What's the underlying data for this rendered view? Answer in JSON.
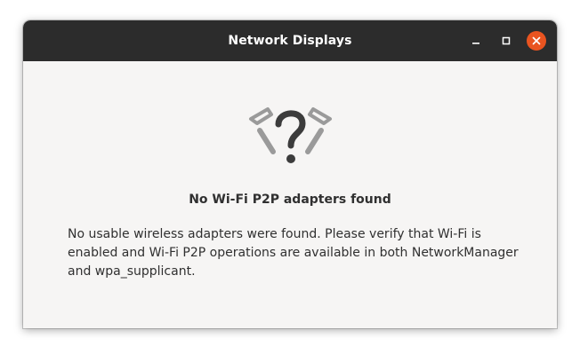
{
  "window": {
    "title": "Network Displays"
  },
  "controls": {
    "minimize_icon": "minimize-icon",
    "maximize_icon": "maximize-icon",
    "close_icon": "close-icon",
    "close_color": "#e95420"
  },
  "main": {
    "status_icon": "wifi-question-icon",
    "heading": "No Wi-Fi P2P adapters found",
    "description": "No usable wireless adapters were found. Please verify that Wi-Fi is enabled and Wi-Fi P2P operations are available in both NetworkManager and wpa_supplicant."
  }
}
